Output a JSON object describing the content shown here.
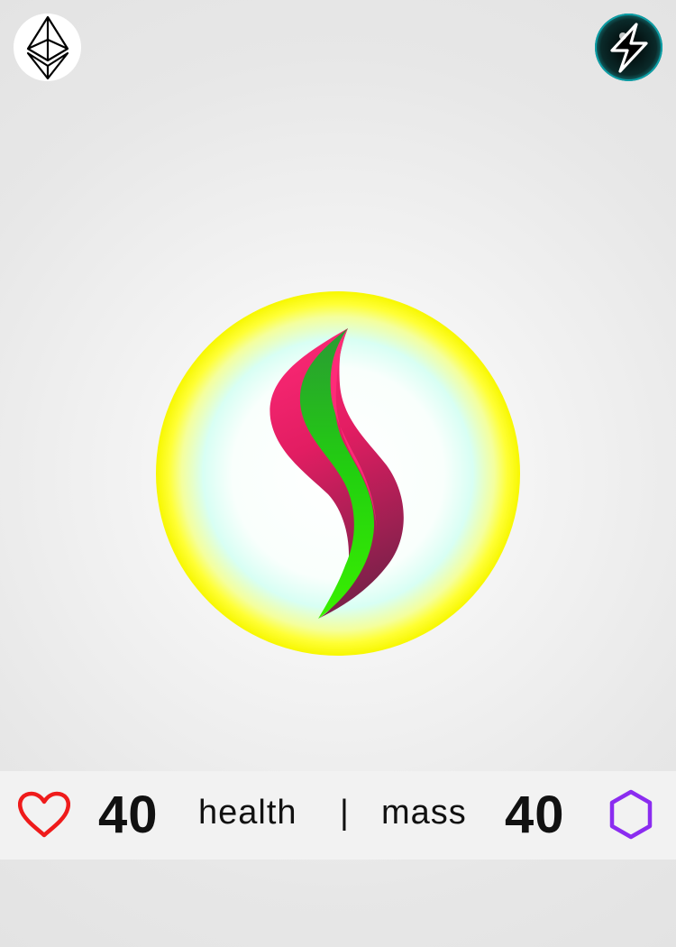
{
  "icons": {
    "top_left": "ethereum-logo-icon",
    "top_right": "lightning-bolt-icon",
    "center": "crimson-green-s-wave-orb",
    "stat_left": "heart-icon",
    "stat_right": "hexagon-icon"
  },
  "stats": {
    "health_value": "40",
    "health_label": "health",
    "divider": "|",
    "mass_label": "mass",
    "mass_value": "40"
  },
  "colors": {
    "orb_ring": "#ffff1a",
    "orb_glow": "#c9fff0",
    "wave_pink": "#ff2472",
    "wave_dark": "#8e1f52",
    "wave_green": "#22dd11",
    "heart": "#ef1b1b",
    "hexagon": "#8b2cf0",
    "bolt_badge": "#1ec8cc"
  }
}
